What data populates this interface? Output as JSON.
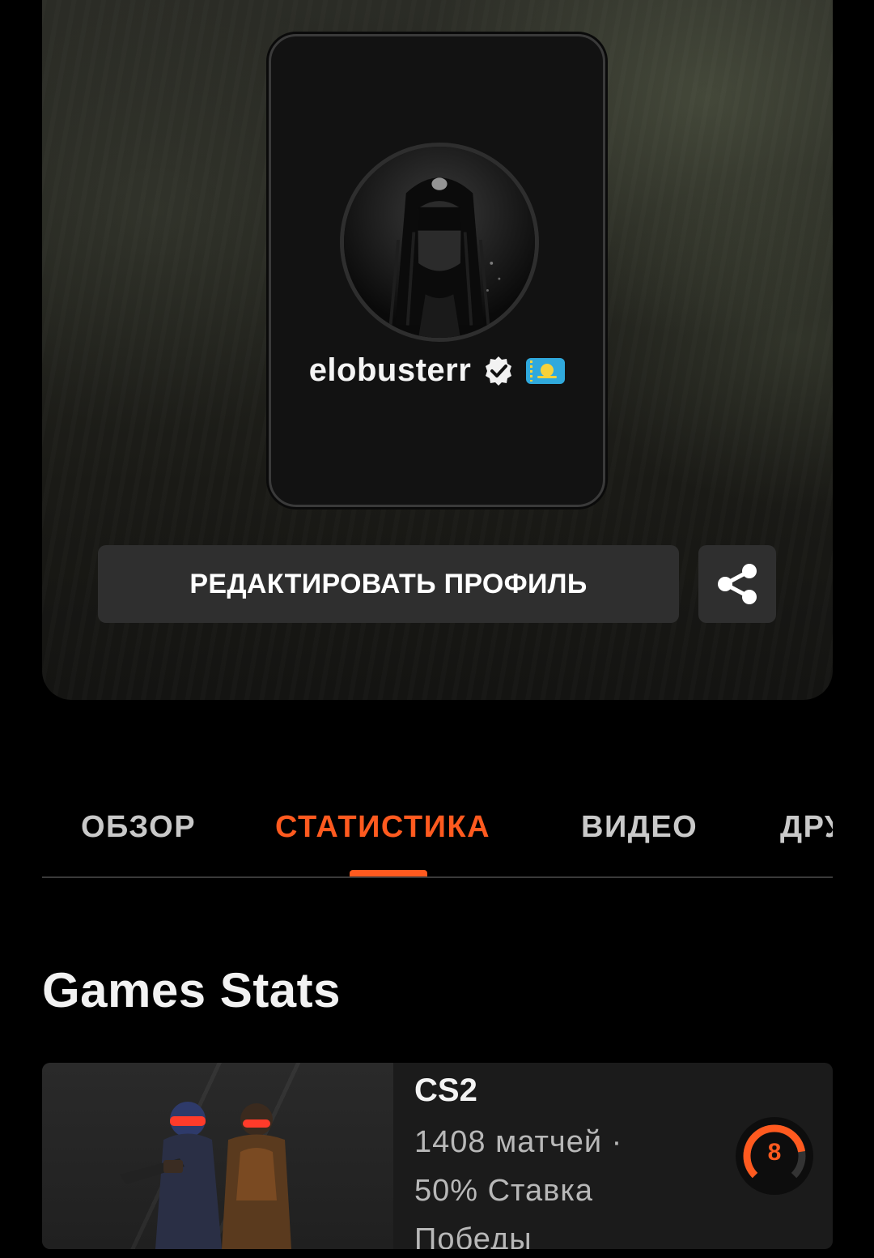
{
  "profile": {
    "username": "elobusterr",
    "country": "Kazakhstan"
  },
  "actions": {
    "edit_label": "РЕДАКТИРОВАТЬ ПРОФИЛЬ"
  },
  "tabs": [
    {
      "label": "ОБЗОР",
      "active": false
    },
    {
      "label": "СТАТИСТИКА",
      "active": true
    },
    {
      "label": "ВИДЕО",
      "active": false
    },
    {
      "label": "ДРУЗЬЯ",
      "active": false
    }
  ],
  "stats_section": {
    "title": "Games Stats"
  },
  "games": [
    {
      "name": "CS2",
      "matches": "1408 матчей ·",
      "winrate": "50% Ставка",
      "winrate_suffix": "Победы",
      "level": "8"
    }
  ],
  "colors": {
    "accent": "#ff5a1f",
    "button_bg": "#2f2f2f",
    "background": "#000000"
  }
}
